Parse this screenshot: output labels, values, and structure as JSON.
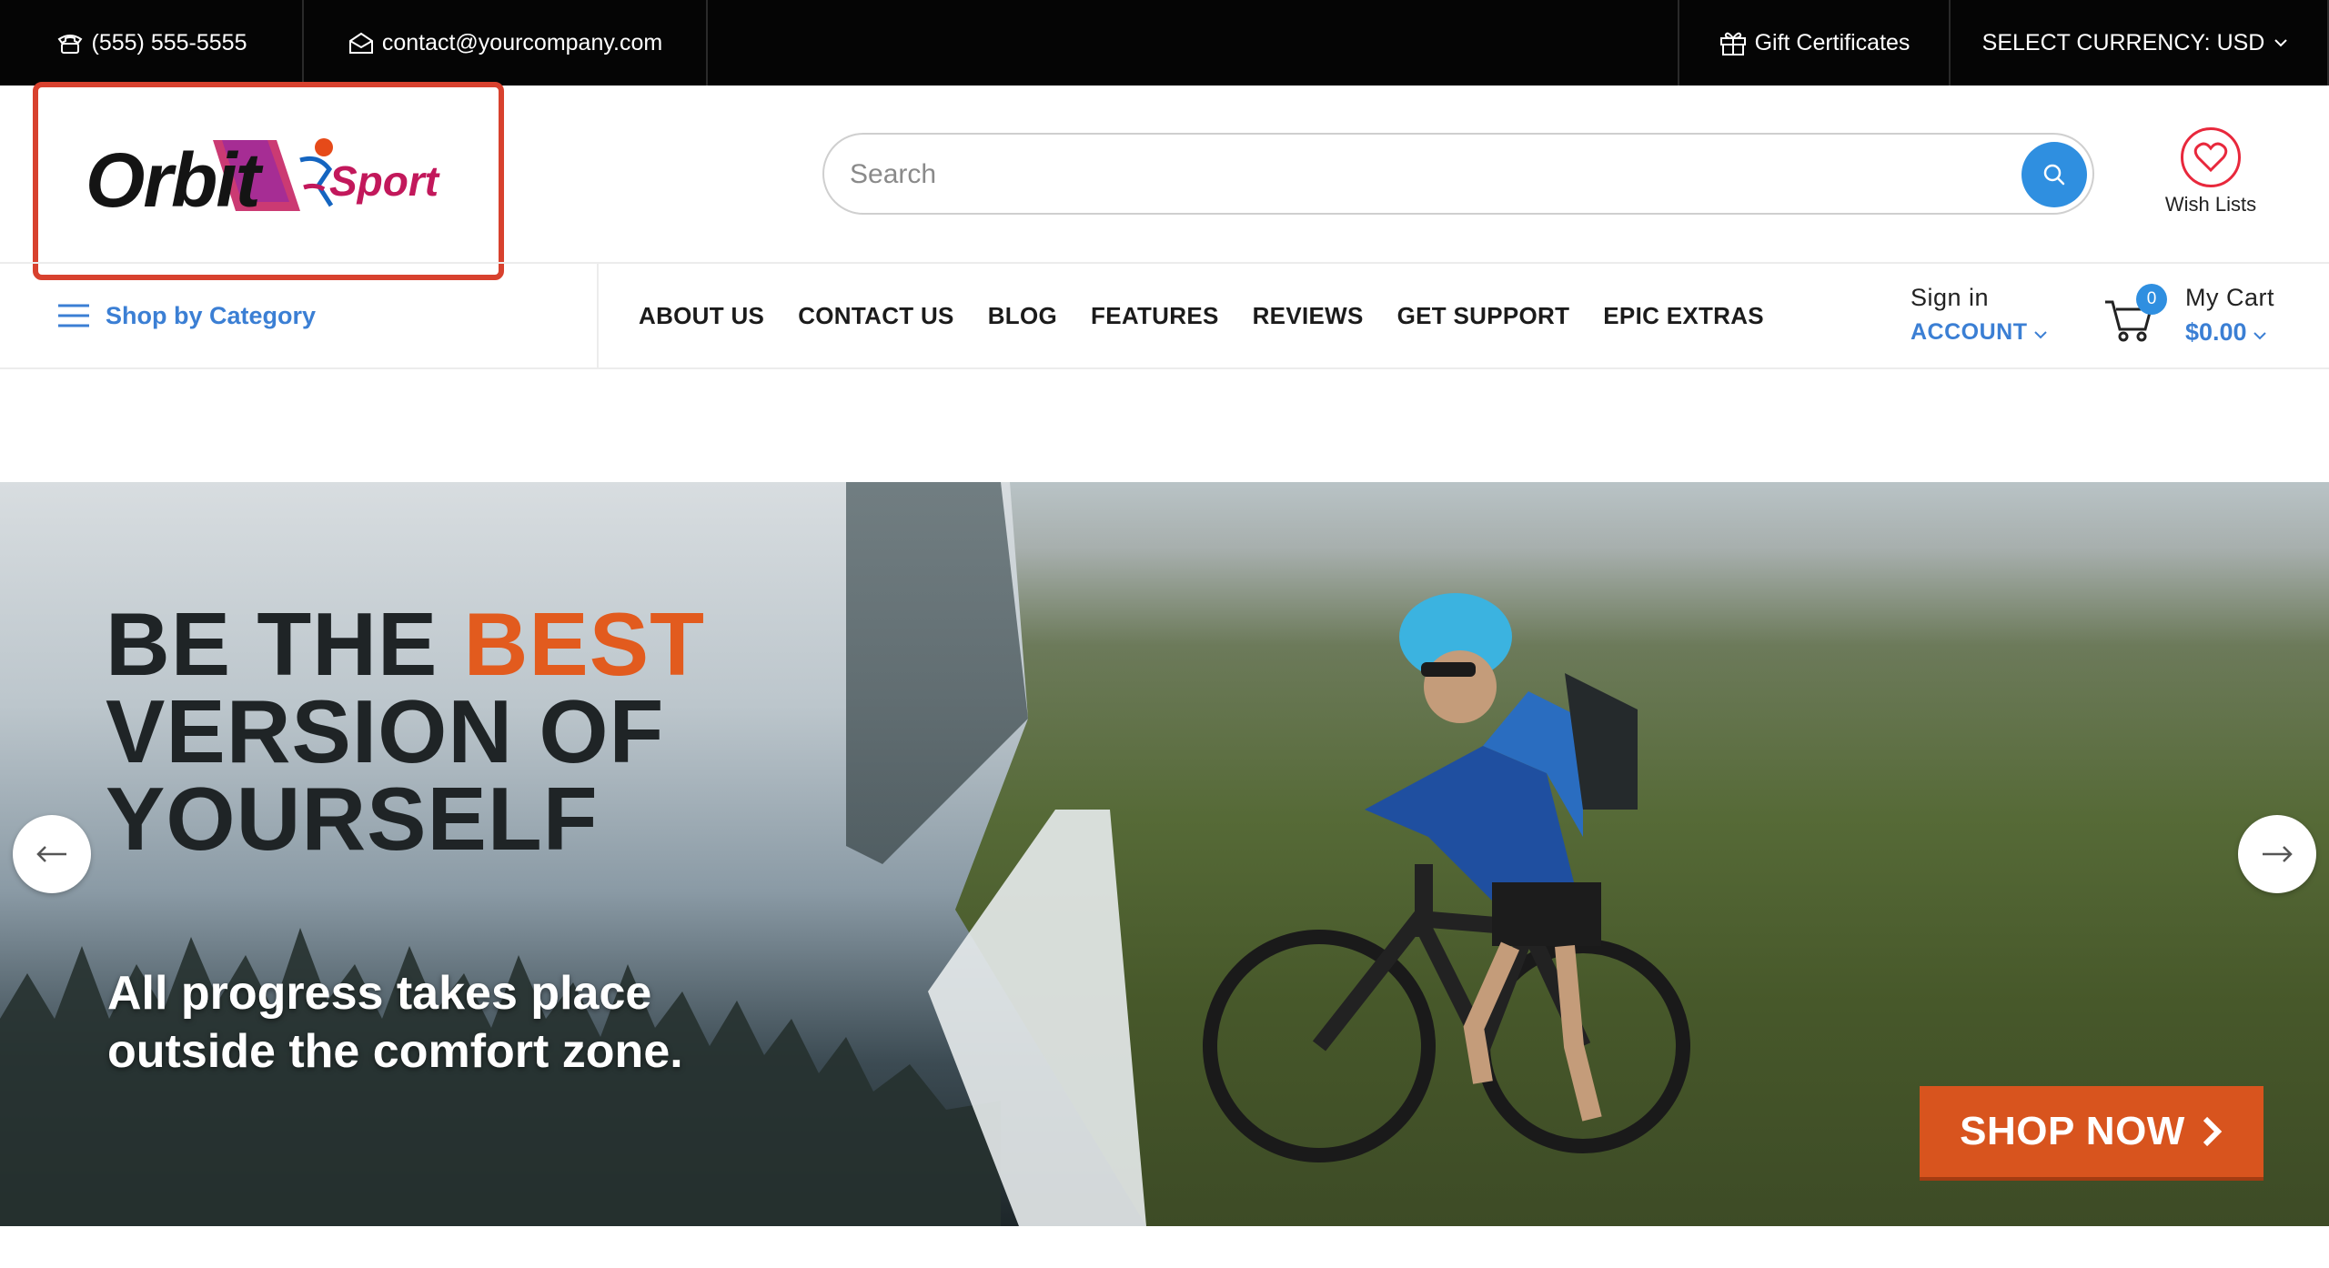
{
  "topbar": {
    "phone": "(555) 555-5555",
    "email": "contact@yourcompany.com",
    "gift": "Gift Certificates",
    "currency": "SELECT CURRENCY: USD"
  },
  "logo": {
    "word1": "Orbit",
    "word2": "Sport"
  },
  "search": {
    "placeholder": "Search"
  },
  "wishlist": {
    "label": "Wish Lists"
  },
  "nav": {
    "shop_by_category": "Shop by Category",
    "items": [
      "ABOUT US",
      "CONTACT US",
      "BLOG",
      "FEATURES",
      "REVIEWS",
      "GET SUPPORT",
      "EPIC EXTRAS"
    ]
  },
  "account": {
    "sign_in": "Sign in",
    "label": "ACCOUNT"
  },
  "cart": {
    "count": "0",
    "label": "My Cart",
    "total": "$0.00"
  },
  "hero": {
    "line1a": "BE THE ",
    "line1b": "BEST",
    "line2": "VERSION OF",
    "line3": "YOURSELF",
    "tag1": "All progress takes place",
    "tag2": "outside the comfort zone.",
    "cta": "SHOP NOW"
  },
  "colors": {
    "accent_blue": "#2f8fe0",
    "link_blue": "#3b7fd4",
    "cta_orange": "#d8541e",
    "highlight_red": "#d8412e"
  }
}
